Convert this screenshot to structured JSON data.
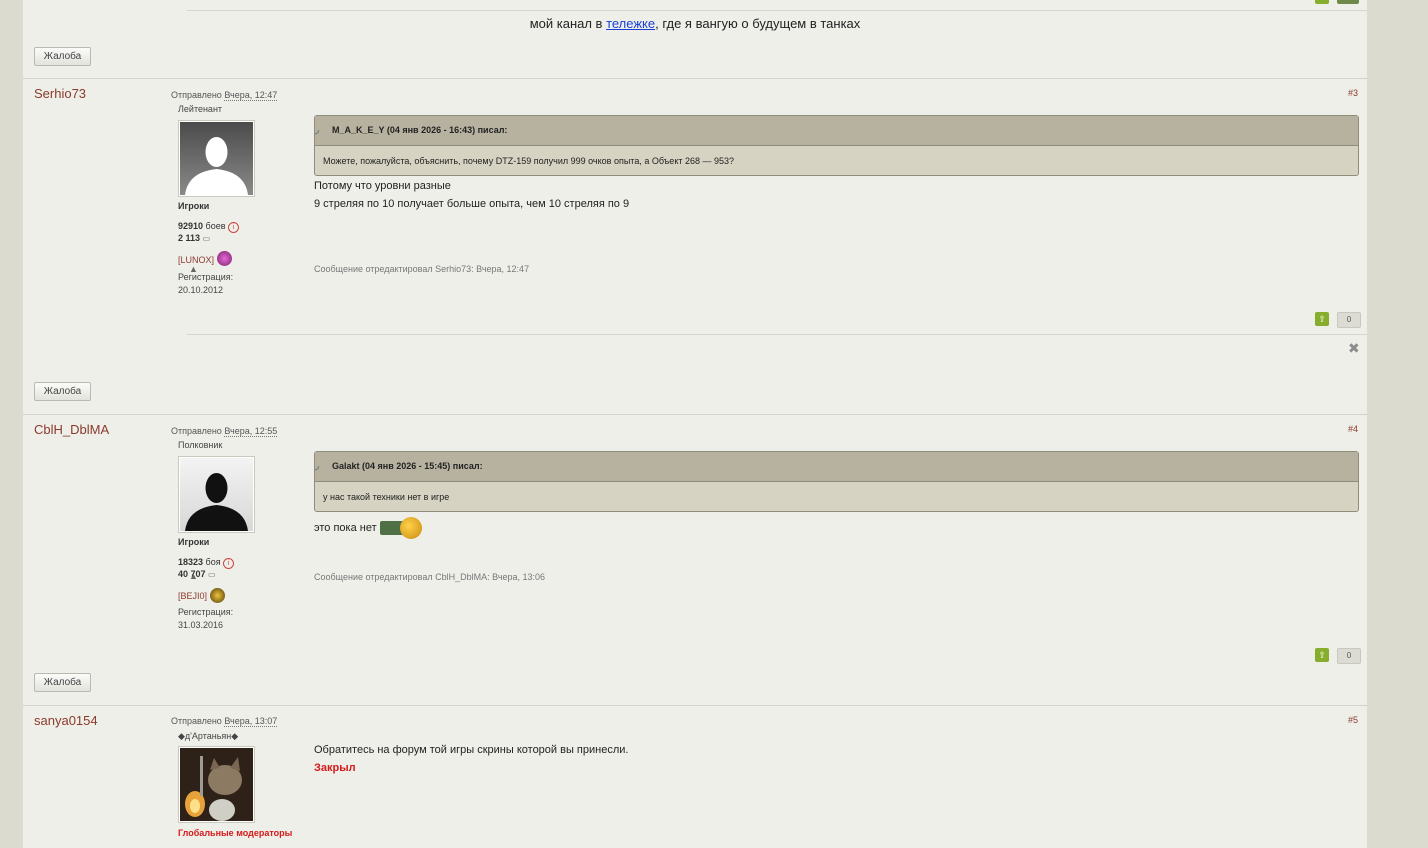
{
  "top_post": {
    "signature_prefix": "мой канал в ",
    "signature_link": "тележке",
    "signature_suffix": ", где я вангую о будущем в танках",
    "report_label": "Жалоба"
  },
  "posts": [
    {
      "author": "Serhio73",
      "posted_prefix": "Отправлено",
      "posted_date": "Вчера, 12:47",
      "number": "#3",
      "rank": "Лейтенант",
      "group": "Игроки",
      "battles": "92910",
      "battles_label": "боев",
      "messages": "2 113",
      "clan": "[LUNOX]",
      "reg_label": "Регистрация:",
      "reg_date": "20.10.2012",
      "quote_header": "M_A_K_E_Y (04 янв 2026 - 16:43) писал:",
      "quote_body": "Можете, пожалуйста, объяснить, почему DTZ-159 получил 999 очков опыта, а Объект 268 — 953?",
      "lines": [
        "Потому что уровни разные",
        "9 стреляя по 10 получает больше опыта, чем 10 стреляя по 9"
      ],
      "edited": "Сообщение отредактировал Serhio73: Вчера, 12:47",
      "votes": "0",
      "report_label": "Жалоба"
    },
    {
      "author": "CblH_DblMA",
      "posted_prefix": "Отправлено",
      "posted_date": "Вчера, 12:55",
      "number": "#4",
      "rank": "Полковник",
      "group": "Игроки",
      "battles": "18323",
      "battles_label": "боя",
      "messages": "40 707",
      "clan": "[BEJI0]",
      "reg_label": "Регистрация:",
      "reg_date": "31.03.2016",
      "quote_header": "Galakt (04 янв 2026 - 15:45) писал:",
      "quote_body": "у нас такой техники нет в игре",
      "lines": [
        "это пока нет"
      ],
      "edited": "Сообщение отредактировал CblH_DblMA: Вчера, 13:06",
      "votes": "0",
      "report_label": "Жалоба"
    },
    {
      "author": "sanya0154",
      "posted_prefix": "Отправлено",
      "posted_date": "Вчера, 13:07",
      "number": "#5",
      "rank": "◆д'Артаньян◆",
      "group": "Глобальные модераторы",
      "lines": [
        "Обратитесь на форум той игры скрины которой вы принесли."
      ],
      "closed": "Закрыл"
    }
  ],
  "colors": {
    "accent": "#8a3a2c",
    "vote_green": "#86ad2c",
    "moderator_red": "#d51a1a",
    "link": "#1a3fd6"
  },
  "icons": [
    "quote-icon",
    "info-icon",
    "message-icon",
    "warning-icon",
    "vote-up-icon",
    "close-icon"
  ]
}
